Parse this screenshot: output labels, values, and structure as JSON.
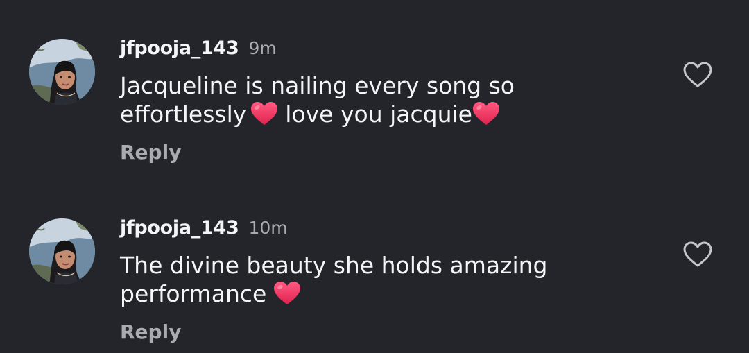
{
  "comments": [
    {
      "username": "jfpooja_143",
      "time": "9m",
      "text_parts": [
        "Jacqueline is nailing every song so effortlessly",
        "love you jacquie"
      ],
      "reply_label": "Reply",
      "like_icon": "heart-outline-icon"
    },
    {
      "username": "jfpooja_143",
      "time": "10m",
      "text_parts": [
        "The divine beauty she holds amazing performance"
      ],
      "reply_label": "Reply",
      "like_icon": "heart-outline-icon"
    }
  ],
  "colors": {
    "background": "#24252a",
    "text_primary": "#f4f5f7",
    "text_secondary": "#a9abb1",
    "heart_emoji": "#f0365f"
  }
}
